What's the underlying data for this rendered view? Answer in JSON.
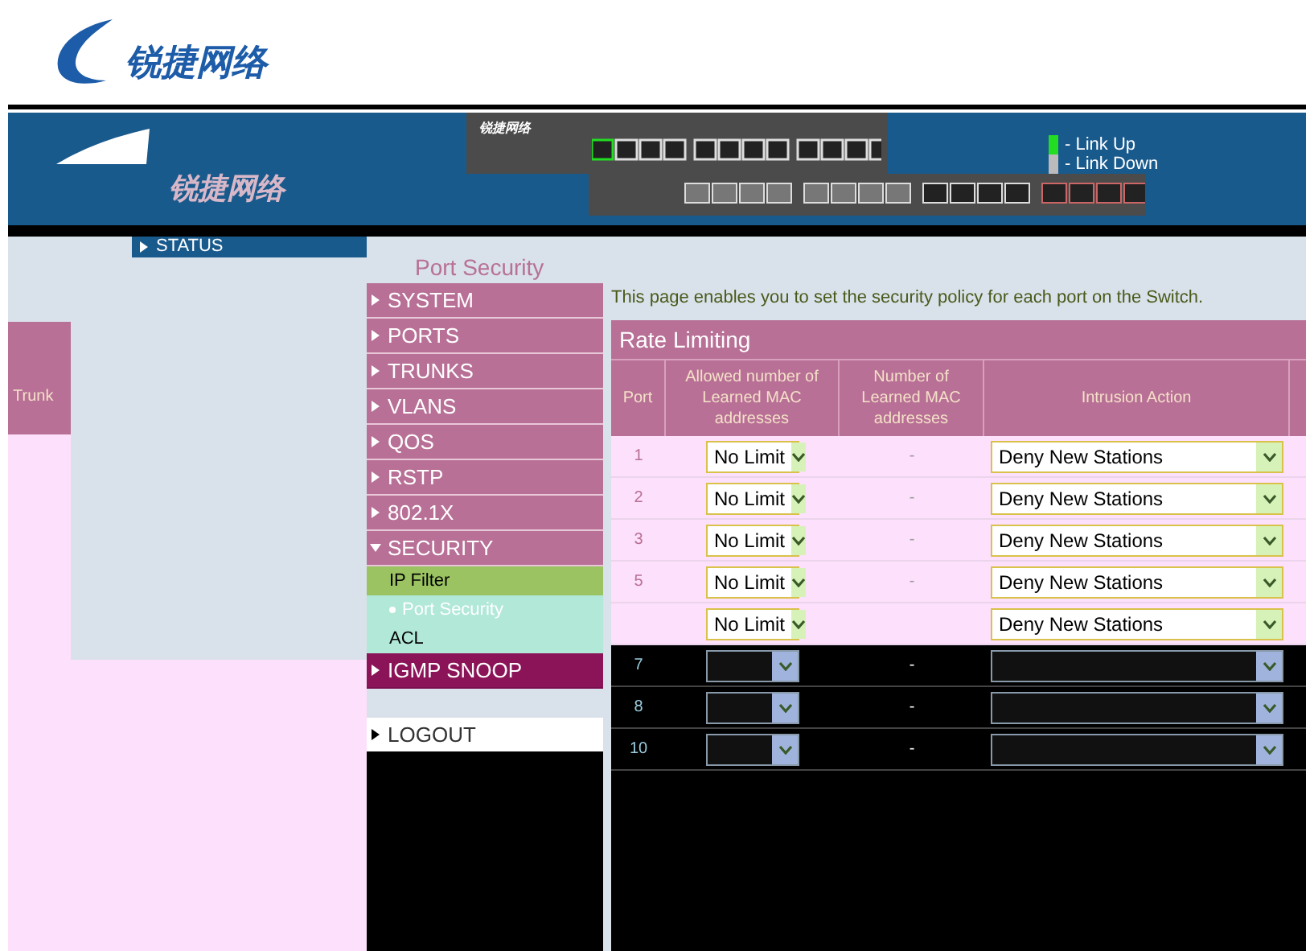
{
  "logo": {
    "text": "锐捷网络"
  },
  "banner": {
    "logo_text": "锐捷网络",
    "panel_logo_text": "锐捷网络",
    "legend": [
      {
        "label": "- Link Up",
        "color": "#22dd22"
      },
      {
        "label": "- Link Down",
        "color": "#bbbbbb"
      }
    ]
  },
  "status_tab": {
    "label": "STATUS"
  },
  "page_title": "Port Security",
  "left_panel": {
    "header": "Trunk"
  },
  "menu": [
    {
      "label": "SYSTEM",
      "expanded": false
    },
    {
      "label": "PORTS",
      "expanded": false
    },
    {
      "label": "TRUNKS",
      "expanded": false
    },
    {
      "label": "VLANS",
      "expanded": false
    },
    {
      "label": "QOS",
      "expanded": false
    },
    {
      "label": "RSTP",
      "expanded": false
    },
    {
      "label": "802.1X",
      "expanded": false
    },
    {
      "label": "SECURITY",
      "expanded": true,
      "children": [
        {
          "label": "IP Filter",
          "selected": false
        },
        {
          "label": "Port Security",
          "selected": true
        },
        {
          "label": "ACL",
          "selected": false
        }
      ]
    },
    {
      "label": "IGMP SNOOP",
      "expanded": false
    },
    {
      "label": "LOGOUT",
      "expanded": false
    }
  ],
  "description": "This page enables you to set the security policy for each port on the Switch.",
  "table": {
    "title": "Rate Limiting",
    "columns": [
      "Port",
      "Allowed number of Learned MAC addresses",
      "Number of Learned MAC addresses",
      "Intrusion Action"
    ],
    "rows": [
      {
        "kind": "light",
        "port": "1",
        "allowed": "No Limit",
        "learned": "-",
        "action": "Deny New Stations"
      },
      {
        "kind": "light",
        "port": "2",
        "allowed": "No Limit",
        "learned": "-",
        "action": "Deny New Stations"
      },
      {
        "kind": "light",
        "port": "3",
        "allowed": "No Limit",
        "learned": "-",
        "action": "Deny New Stations"
      },
      {
        "kind": "light",
        "port": "5",
        "allowed": "No Limit",
        "learned": "-",
        "action": "Deny New Stations"
      },
      {
        "kind": "light",
        "port": "",
        "allowed": "No Limit",
        "learned": "",
        "action": "Deny New Stations"
      },
      {
        "kind": "dark",
        "port": "7",
        "learned": "-"
      },
      {
        "kind": "dark",
        "port": "8",
        "learned": "-"
      },
      {
        "kind": "dark",
        "port": "10",
        "learned": "-"
      }
    ]
  }
}
